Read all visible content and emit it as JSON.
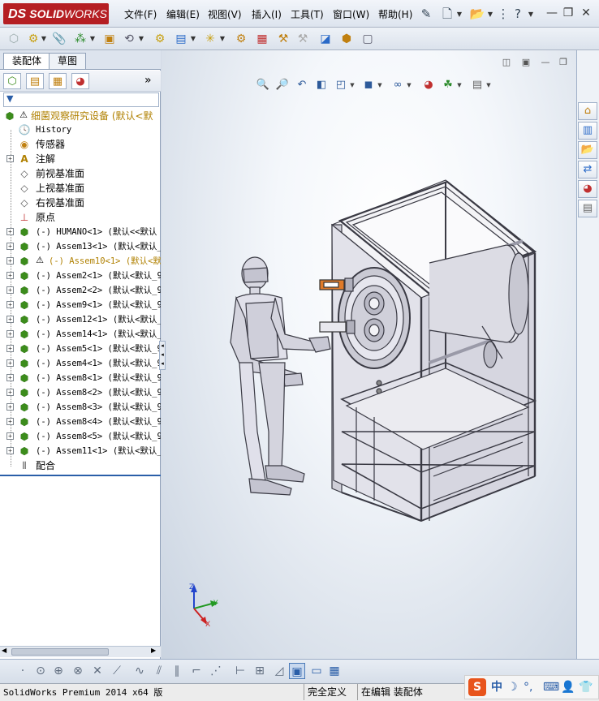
{
  "app": {
    "logo_prefix": "DS",
    "logo_text": "SOLID",
    "logo_text2": "WORKS"
  },
  "menu": [
    "文件(F)",
    "编辑(E)",
    "视图(V)",
    "插入(I)",
    "工具(T)",
    "窗口(W)",
    "帮助(H)"
  ],
  "panel_tabs": [
    "装配体",
    "草图"
  ],
  "panel_tools_more": "»",
  "tree": {
    "root": "细菌观察研究设备  (默认<默",
    "items": [
      {
        "label": "History",
        "mono": true
      },
      {
        "label": "传感器"
      },
      {
        "label": "注解"
      },
      {
        "label": "前视基准面"
      },
      {
        "label": "上视基准面"
      },
      {
        "label": "右视基准面"
      },
      {
        "label": "原点"
      }
    ],
    "components": [
      {
        "label": "(-) HUMANO<1> (默认<<默认",
        "warn": false
      },
      {
        "label": "(-) Assem13<1> (默认<默认_",
        "warn": false
      },
      {
        "label": "(-) Assem10<1> (默认<默",
        "warn": true
      },
      {
        "label": "(-) Assem2<1> (默认<默认_9",
        "warn": false
      },
      {
        "label": "(-) Assem2<2> (默认<默认_9",
        "warn": false
      },
      {
        "label": "(-) Assem9<1> (默认<默认_9",
        "warn": false
      },
      {
        "label": "(-) Assem12<1> (默认<默认_",
        "warn": false
      },
      {
        "label": "(-) Assem14<1> (默认<默认_",
        "warn": false
      },
      {
        "label": "(-) Assem5<1> (默认<默认_9",
        "warn": false
      },
      {
        "label": "(-) Assem4<1> (默认<默认_9",
        "warn": false
      },
      {
        "label": "(-) Assem8<1> (默认<默认_9",
        "warn": false
      },
      {
        "label": "(-) Assem8<2> (默认<默认_9",
        "warn": false
      },
      {
        "label": "(-) Assem8<3> (默认<默认_9",
        "warn": false
      },
      {
        "label": "(-) Assem8<4> (默认<默认_9",
        "warn": false
      },
      {
        "label": "(-) Assem8<5> (默认<默认_9",
        "warn": false
      },
      {
        "label": "(-) Assem11<1> (默认<默认_",
        "warn": false
      }
    ],
    "mates": "配合"
  },
  "triad": {
    "x": "X",
    "y": "Y",
    "z": "Z"
  },
  "status": {
    "product": "SolidWorks Premium 2014 x64 版",
    "definition": "完全定义",
    "mode": "在编辑 装配体"
  },
  "ime": {
    "brand": "S",
    "lang": "中"
  },
  "colors": {
    "logo_red": "#b51e23",
    "selection_blue": "#2a5ea8",
    "component_green": "#3c8c1c",
    "warning_yellow": "#f2c200"
  }
}
